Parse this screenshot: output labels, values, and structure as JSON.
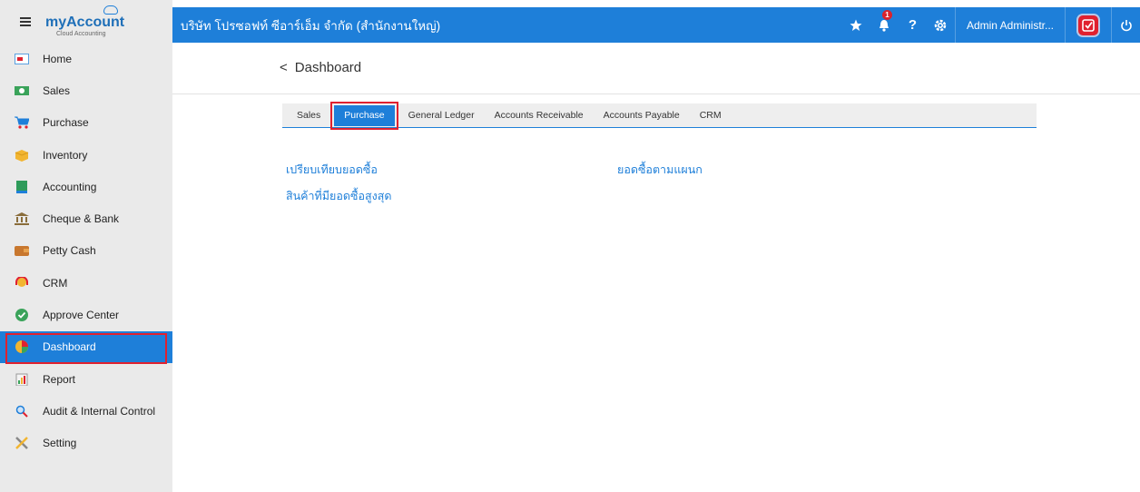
{
  "sidebar": {
    "logo_text": "myAccount",
    "logo_sub": "Cloud Accounting",
    "items": [
      {
        "label": "Home"
      },
      {
        "label": "Sales"
      },
      {
        "label": "Purchase"
      },
      {
        "label": "Inventory"
      },
      {
        "label": "Accounting"
      },
      {
        "label": "Cheque & Bank"
      },
      {
        "label": "Petty Cash"
      },
      {
        "label": "CRM"
      },
      {
        "label": "Approve Center"
      },
      {
        "label": "Dashboard",
        "active": true
      },
      {
        "label": "Report"
      },
      {
        "label": "Audit & Internal Control"
      },
      {
        "label": "Setting"
      }
    ]
  },
  "topbar": {
    "company": "บริษัท โปรซอฟท์ ซีอาร์เอ็ม จำกัด (สำนักงานใหญ่)",
    "notification_count": "1",
    "help_symbol": "?",
    "user": "Admin Administr..."
  },
  "page": {
    "title": "Dashboard",
    "back_symbol": "<"
  },
  "tabs": [
    {
      "label": "Sales"
    },
    {
      "label": "Purchase",
      "active": true
    },
    {
      "label": "General Ledger"
    },
    {
      "label": "Accounts Receivable"
    },
    {
      "label": "Accounts Payable"
    },
    {
      "label": "CRM"
    }
  ],
  "links": {
    "compare_purchase": "เปรียบเทียบยอดซื้อ",
    "top_products": "สินค้าที่มียอดซื้อสูงสุด",
    "by_department": "ยอดซื้อตามแผนก"
  },
  "colors": {
    "primary": "#1e7fd9",
    "highlight": "#e0212f",
    "sidebar_bg": "#eaeaea"
  }
}
